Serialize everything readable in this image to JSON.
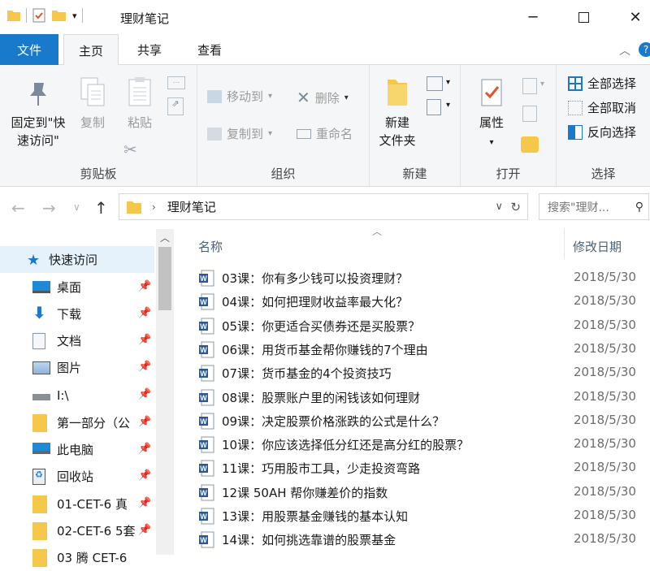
{
  "window": {
    "title": "理财笔记",
    "controls": [
      "minimize",
      "maximize",
      "close"
    ]
  },
  "quick_access_toolbar": [
    "folder-icon",
    "properties-check-icon",
    "new-folder-icon",
    "dropdown-icon"
  ],
  "tabs": [
    {
      "label": "文件",
      "state": "file"
    },
    {
      "label": "主页",
      "state": "active"
    },
    {
      "label": "共享",
      "state": "normal"
    },
    {
      "label": "查看",
      "state": "normal"
    }
  ],
  "ribbon": {
    "clipboard": {
      "label": "剪贴板",
      "pin_line1": "固定到\"快",
      "pin_line2": "速访问\"",
      "copy": "复制",
      "paste": "粘贴"
    },
    "organize": {
      "label": "组织",
      "move_to": "移动到",
      "copy_to": "复制到",
      "delete": "删除",
      "rename": "重命名"
    },
    "new": {
      "label": "新建",
      "new_folder_line1": "新建",
      "new_folder_line2": "文件夹"
    },
    "open": {
      "label": "打开",
      "properties": "属性"
    },
    "select": {
      "label": "选择",
      "select_all": "全部选择",
      "select_none": "全部取消",
      "invert": "反向选择"
    }
  },
  "address": {
    "path_item": "理财笔记",
    "search_placeholder": "搜索\"理财..."
  },
  "nav": {
    "items": [
      {
        "label": "快速访问",
        "icon": "star-icon",
        "pinned": false,
        "selected": true
      },
      {
        "label": "桌面",
        "icon": "desktop-icon",
        "pinned": true
      },
      {
        "label": "下载",
        "icon": "download-icon",
        "pinned": true
      },
      {
        "label": "文档",
        "icon": "document-icon",
        "pinned": true
      },
      {
        "label": "图片",
        "icon": "picture-icon",
        "pinned": true
      },
      {
        "label": "I:\\",
        "icon": "drive-icon",
        "pinned": true
      },
      {
        "label": "第一部分（公",
        "icon": "folder-icon",
        "pinned": true
      },
      {
        "label": "此电脑",
        "icon": "computer-icon",
        "pinned": true
      },
      {
        "label": "回收站",
        "icon": "recycle-bin-icon",
        "pinned": true
      },
      {
        "label": "01-CET-6 真",
        "icon": "folder-icon",
        "pinned": true
      },
      {
        "label": "02-CET-6 5套",
        "icon": "folder-icon",
        "pinned": true
      },
      {
        "label": "03 腾 CET-6",
        "icon": "folder-icon",
        "pinned": true
      }
    ]
  },
  "columns": {
    "name": "名称",
    "modified": "修改日期"
  },
  "files": [
    {
      "name": "03课：你有多少钱可以投资理财？",
      "date": "2018/5/30"
    },
    {
      "name": "04课：如何把理财收益率最大化？",
      "date": "2018/5/30"
    },
    {
      "name": "05课：你更适合买债券还是买股票？",
      "date": "2018/5/30"
    },
    {
      "name": "06课：用货币基金帮你赚钱的7个理由",
      "date": "2018/5/30"
    },
    {
      "name": "07课：货币基金的4个投资技巧",
      "date": "2018/5/30"
    },
    {
      "name": "08课：股票账户里的闲钱该如何理财",
      "date": "2018/5/30"
    },
    {
      "name": "09课：决定股票价格涨跌的公式是什么？",
      "date": "2018/5/30"
    },
    {
      "name": "10课：你应该选择低分红还是高分红的股票？",
      "date": "2018/5/30"
    },
    {
      "name": "11课：巧用股市工具，少走投资弯路",
      "date": "2018/5/30"
    },
    {
      "name": "12课 50AH 帮你赚差价的指数",
      "date": "2018/5/30"
    },
    {
      "name": "13课：用股票基金赚钱的基本认知",
      "date": "2018/5/30"
    },
    {
      "name": "14课：如何挑选靠谱的股票基金",
      "date": "2018/5/30"
    }
  ],
  "colors": {
    "accent": "#1979ca",
    "folder": "#f5c84b",
    "word": "#2b5797"
  }
}
